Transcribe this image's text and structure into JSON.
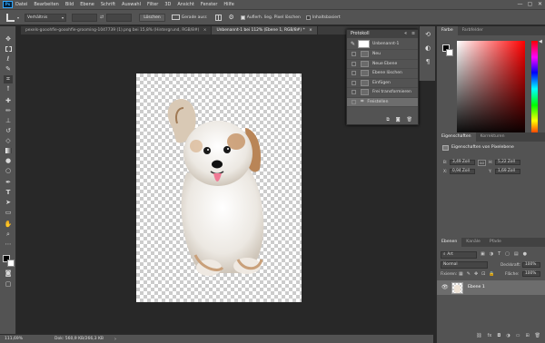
{
  "menubar": {
    "logo": "Ps",
    "items": [
      "Datei",
      "Bearbeiten",
      "Bild",
      "Ebene",
      "Schrift",
      "Auswahl",
      "Filter",
      "3D",
      "Ansicht",
      "Fenster",
      "Hilfe"
    ],
    "win": [
      "—",
      "▢",
      "✕"
    ]
  },
  "options": {
    "ratio": "Verhältnis",
    "clear": "Löschen",
    "straighten": "Gerade ausr.",
    "delete_cropped": "Auflerh. lieg. Pixel löschen",
    "content_aware": "Inhaltsbasiert"
  },
  "tabs": [
    {
      "label": "pexels-gooohfie-gooohfie-grooming-1047739 (1).png bei 15,8% (Hintergrund, RGB/8#)",
      "close": "×"
    },
    {
      "label": "Unbenannt-1 bei 112% (Ebene 1, RGB/8#) *",
      "close": "×"
    }
  ],
  "protokoll": {
    "title": "Protokoll",
    "snapshot": "Unbenannt-1",
    "rows": [
      "Neu",
      "Neue Ebene",
      "Ebene löschen",
      "Einfügen",
      "Frei transformieren",
      "Freistellen"
    ],
    "collapse": "«",
    "menu": "≡"
  },
  "color_panel": {
    "tab1": "Farbe",
    "tab2": "Farbfelder",
    "hue_arrow": "◀"
  },
  "properties": {
    "tab1": "Eigenschaften",
    "tab2": "Korrekturen",
    "subtitle": "Eigenschaften von Pixelebene",
    "link": "GO",
    "b_label": "B:",
    "b_value": "3,49 Zoll",
    "h_label": "H:",
    "h_value": "5,22 Zoll",
    "x_label": "X:",
    "x_value": "0,94 Zoll",
    "y_label": "Y:",
    "y_value": "1,69 Zoll"
  },
  "layers": {
    "tab1": "Ebenen",
    "tab2": "Kanäle",
    "tab3": "Pfade",
    "filter": "Art",
    "blend": "Normal",
    "opacity_label": "Deckkraft:",
    "opacity": "100%",
    "lock_label": "Fixieren:",
    "fill_label": "Fläche:",
    "fill": "100%",
    "layer_name": "Ebene 1"
  },
  "status": {
    "zoom": "111,69%",
    "doc": "Dok: 560,9 KB/266,3 KB"
  },
  "colors": {
    "accent": "#31a8ff",
    "panel": "#535353",
    "canvas": "#282828"
  },
  "icons": {
    "eye": "eye-icon",
    "search": "search-icon"
  }
}
